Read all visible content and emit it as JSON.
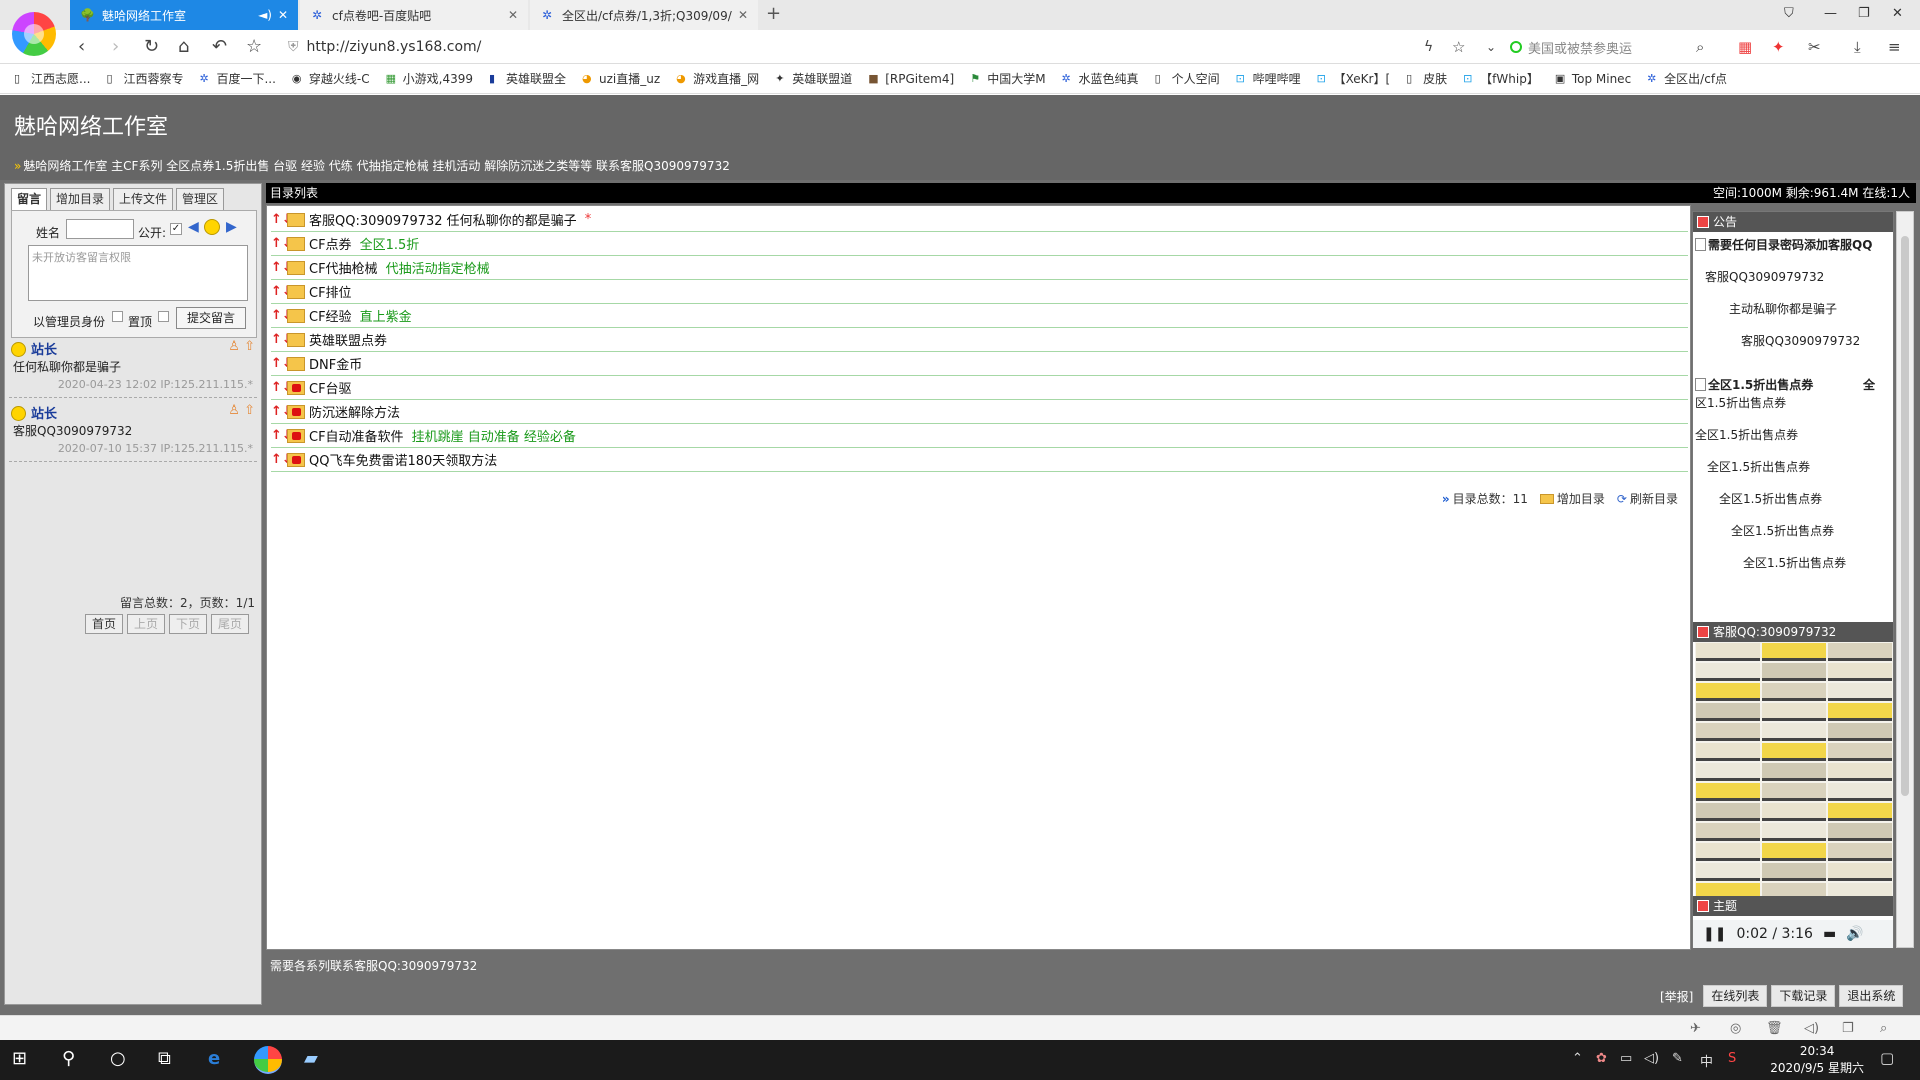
{
  "browser": {
    "tabs": [
      {
        "title": "魅哈网络工作室",
        "audio": "speaker-icon"
      },
      {
        "title": "cf点卷吧-百度贴吧"
      },
      {
        "title": "全区出/cf点券/1,3折;Q309/09/"
      }
    ],
    "new_tab": "+",
    "url": "http://ziyun8.ys168.com/",
    "search_placeholder": "美国或被禁参奥运",
    "bookmarks": [
      "江西志愿...",
      "江西蓉察专",
      "百度一下...",
      "穿越火线-C",
      "小游戏,4399",
      "英雄联盟全",
      "uzi直播_uz",
      "游戏直播_网",
      "英雄联盟道",
      "[RPGitem4]",
      "中国大学M",
      "水蓝色纯真",
      "个人空间",
      "哔哩哔哩",
      "【XeKr】[",
      "皮肤",
      "【fWhip】",
      "Top Minec",
      "全区出/cf点"
    ]
  },
  "site": {
    "title": "魅哈网络工作室",
    "subtitle_arrows": "»",
    "subtitle": "魅哈网络工作室 主CF系列 全区点券1.5折出售 台驱 经验 代练 代抽指定枪械 挂机活动 解除防沉迷之类等等 联系客服Q3090979732"
  },
  "left_panel": {
    "tabs": [
      "留言",
      "增加目录",
      "上传文件",
      "管理区"
    ],
    "form": {
      "name_label": "姓名",
      "public_label": "公开:",
      "public_checked": "✓",
      "textarea_placeholder": "未开放访客留言权限",
      "admin_label": "以管理员身份",
      "top_label": "置顶",
      "submit": "提交留言"
    },
    "messages": [
      {
        "author": "站长",
        "text": "任何私聊你都是骗子",
        "meta": "2020-04-23 12:02 IP:125.211.115.*"
      },
      {
        "author": "站长",
        "text": "客服QQ3090979732",
        "meta": "2020-07-10 15:37 IP:125.211.115.*"
      }
    ],
    "stats": "留言总数：2，页数：1/1",
    "pager": [
      "首页",
      "上页",
      "下页",
      "尾页"
    ]
  },
  "directory": {
    "header": "目录列表",
    "space_info": "空间:1000M 剩余:961.4M 在线:1人",
    "rows": [
      {
        "name": "客服QQ:3090979732 任何私聊你的都是骗子",
        "note": "",
        "star": "*",
        "locked": false
      },
      {
        "name": "CF点券",
        "note": "全区1.5折",
        "star": "",
        "locked": false
      },
      {
        "name": "CF代抽枪械",
        "note": "代抽活动指定枪械",
        "star": "",
        "locked": false
      },
      {
        "name": "CF排位",
        "note": "",
        "star": "",
        "locked": false
      },
      {
        "name": "CF经验",
        "note": "直上紫金",
        "star": "",
        "locked": false
      },
      {
        "name": "英雄联盟点券",
        "note": "",
        "star": "",
        "locked": false
      },
      {
        "name": "DNF金币",
        "note": "",
        "star": "",
        "locked": false
      },
      {
        "name": "CF台驱",
        "note": "",
        "star": "",
        "locked": true
      },
      {
        "name": "防沉迷解除方法",
        "note": "",
        "star": "",
        "locked": true
      },
      {
        "name": "CF自动准备软件",
        "note": "挂机跳崖 自动准备 经验必备",
        "star": "",
        "locked": true
      },
      {
        "name": "QQ飞车免费雷诺180天领取方法",
        "note": "",
        "star": "",
        "locked": true
      }
    ],
    "footer": {
      "total_label": "目录总数：",
      "total": "11",
      "add": "增加目录",
      "refresh": "刷新目录"
    }
  },
  "notice": {
    "head": "公告",
    "lines": [
      "需要任何目录密码添加客服QQ",
      "客服QQ3090979732",
      "主动私聊你都是骗子",
      "客服QQ3090979732",
      "全区1.5折出售点券",
      "全",
      "区1.5折出售点券",
      "全区1.5折出售点券",
      "全区1.5折出售点券",
      "全区1.5折出售点券",
      "全区1.5折出售点券",
      "全区1.5折出售点券"
    ],
    "qq_head": "客服QQ:3090979732",
    "theme_head": "主题"
  },
  "player": {
    "time": "0:02 / 3:16"
  },
  "footer": {
    "note": "需要各系列联系客服QQ:3090979732",
    "report": "[举报]",
    "buttons": [
      "在线列表",
      "下载记录",
      "退出系统"
    ]
  },
  "taskbar": {
    "time": "20:34",
    "date": "2020/9/5 星期六",
    "ime": "中"
  }
}
